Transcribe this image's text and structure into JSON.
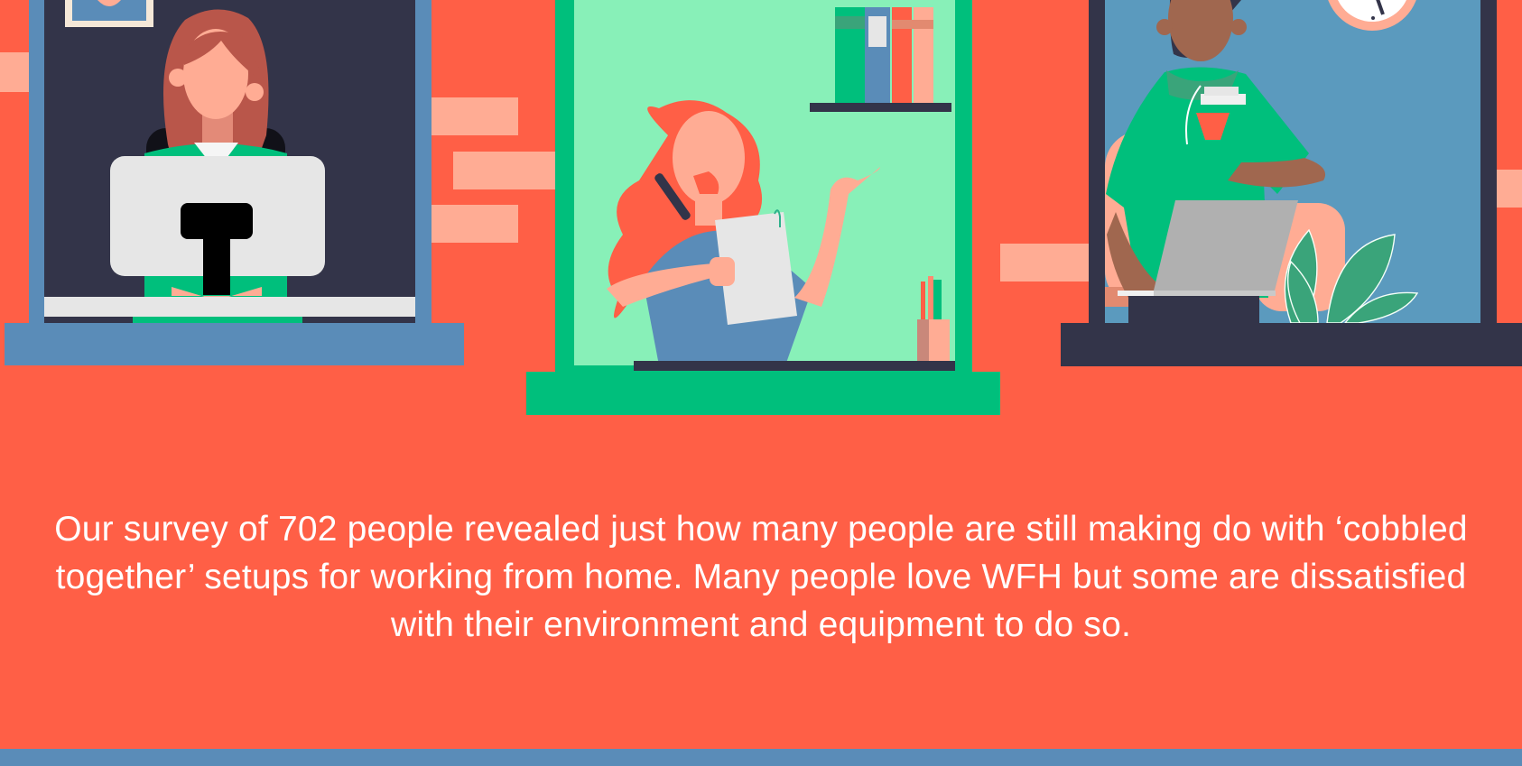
{
  "intro": {
    "text": "Our survey of 702 people revealed just how many people are still making do with ‘cobbled together’ setups for working from home. Many people love WFH but some are dissatisfied with their environment and equipment to do so."
  },
  "colors": {
    "wall": "#ff5f46",
    "brick": "#ffac94",
    "left_window_frame": "#5a8cb8",
    "left_room": "#333449",
    "center_window_frame": "#00bf7c",
    "center_room": "#88f0b8",
    "right_window_frame": "#333449",
    "right_room": "#5b9abe",
    "bottom_bar": "#5a8cb8"
  },
  "illustration": {
    "windows": [
      {
        "id": "left",
        "subject": "person-at-monitor"
      },
      {
        "id": "center",
        "subject": "person-on-phone-with-document"
      },
      {
        "id": "right",
        "subject": "person-with-laptop-and-coffee"
      }
    ]
  }
}
